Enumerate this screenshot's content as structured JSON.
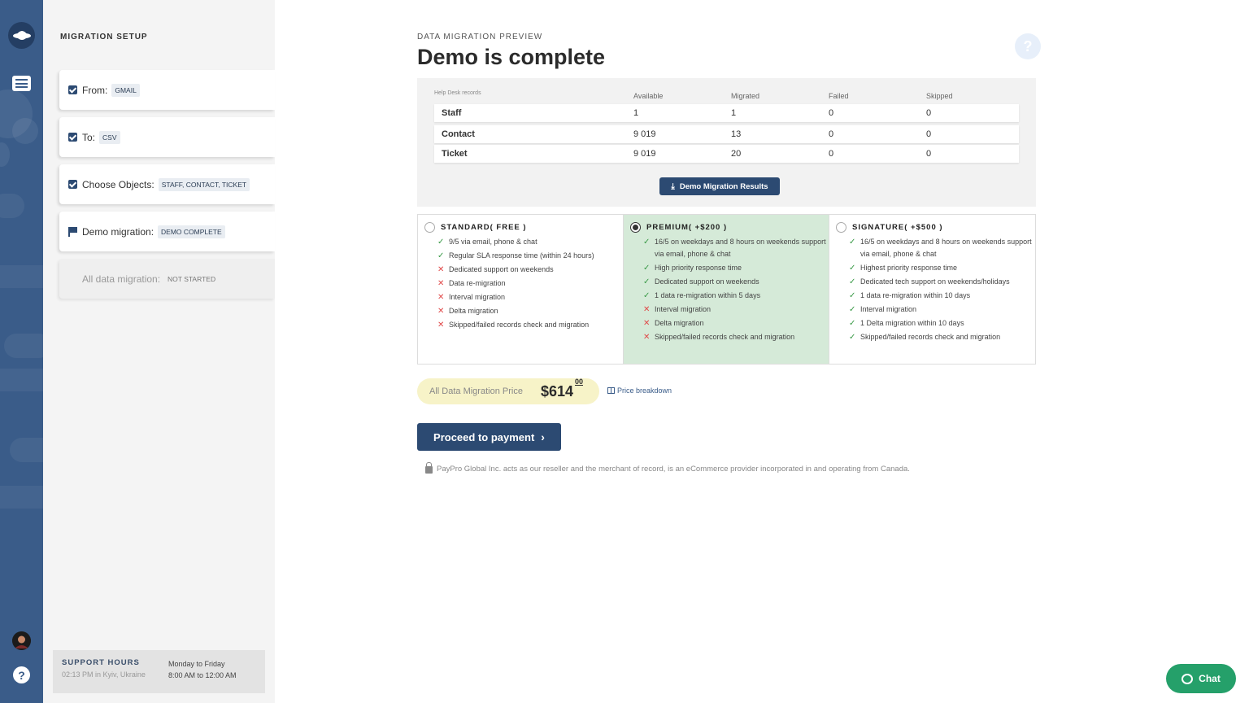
{
  "sidebar": {
    "title": "MIGRATION SETUP",
    "steps": [
      {
        "label": "From:",
        "tag": "GMAIL"
      },
      {
        "label": "To:",
        "tag": "CSV"
      },
      {
        "label": "Choose Objects:",
        "tag": "STAFF, CONTACT, TICKET"
      },
      {
        "label": "Demo migration:",
        "tag": "DEMO COMPLETE"
      },
      {
        "label": "All data migration:",
        "tag": "NOT STARTED"
      }
    ],
    "support": {
      "label": "SUPPORT HOURS",
      "timezone": "02:13 PM in Kyiv, Ukraine",
      "days": "Monday to Friday",
      "hours": "8:00 AM to 12:00 AM"
    }
  },
  "header": {
    "eyebrow": "DATA MIGRATION PREVIEW",
    "title": "Demo is complete",
    "help": "?"
  },
  "records": {
    "columns": [
      "Help Desk records",
      "Available",
      "Migrated",
      "Failed",
      "Skipped"
    ],
    "rows": [
      {
        "name": "Staff",
        "available": "1",
        "migrated": "1",
        "failed": "0",
        "skipped": "0"
      },
      {
        "name": "Contact",
        "available": "9 019",
        "migrated": "13",
        "failed": "0",
        "skipped": "0"
      },
      {
        "name": "Ticket",
        "available": "9 019",
        "migrated": "20",
        "failed": "0",
        "skipped": "0"
      }
    ],
    "download_label": "Demo Migration Results"
  },
  "plans": [
    {
      "name": "STANDARD( FREE )",
      "selected": false,
      "features": [
        {
          "ok": true,
          "text": "9/5 via email, phone & chat"
        },
        {
          "ok": true,
          "text": "Regular SLA response time (within 24 hours)"
        },
        {
          "ok": false,
          "text": "Dedicated support on weekends"
        },
        {
          "ok": false,
          "text": "Data re-migration"
        },
        {
          "ok": false,
          "text": "Interval migration"
        },
        {
          "ok": false,
          "text": "Delta migration"
        },
        {
          "ok": false,
          "text": "Skipped/failed records check and migration"
        }
      ]
    },
    {
      "name": "PREMIUM( +$200 )",
      "selected": true,
      "features": [
        {
          "ok": true,
          "text": "16/5 on weekdays and 8 hours on weekends support via email, phone & chat"
        },
        {
          "ok": true,
          "text": "High priority response time"
        },
        {
          "ok": true,
          "text": "Dedicated support on weekends"
        },
        {
          "ok": true,
          "text": "1 data re-migration within 5 days"
        },
        {
          "ok": false,
          "text": "Interval migration"
        },
        {
          "ok": false,
          "text": "Delta migration"
        },
        {
          "ok": false,
          "text": "Skipped/failed records check and migration"
        }
      ]
    },
    {
      "name": "SIGNATURE( +$500 )",
      "selected": false,
      "features": [
        {
          "ok": true,
          "text": "16/5 on weekdays and 8 hours on weekends support via email, phone & chat"
        },
        {
          "ok": true,
          "text": "Highest priority response time"
        },
        {
          "ok": true,
          "text": "Dedicated tech support on weekends/holidays"
        },
        {
          "ok": true,
          "text": "1 data re-migration within 10 days"
        },
        {
          "ok": true,
          "text": "Interval migration"
        },
        {
          "ok": true,
          "text": "1 Delta migration within 10 days"
        },
        {
          "ok": true,
          "text": "Skipped/failed records check and migration"
        }
      ]
    }
  ],
  "price": {
    "label": "All Data Migration Price",
    "amount": "$614",
    "cents": "00",
    "breakdown_label": "Price breakdown"
  },
  "payment": {
    "button_label": "Proceed to payment",
    "legal": "PayPro Global Inc. acts as our reseller and the merchant of record, is an eCommerce provider incorporated in and operating from Canada."
  },
  "chat": {
    "label": "Chat"
  },
  "colors": {
    "brand": "#2c4a72",
    "rail": "#3a5c89",
    "selected_plan": "#d5ead8",
    "chat": "#25a06a"
  },
  "icons": {
    "check": "✓",
    "cross": "✕"
  }
}
